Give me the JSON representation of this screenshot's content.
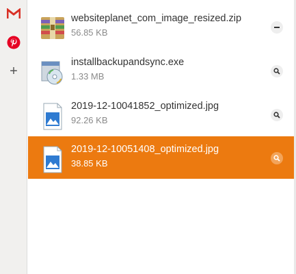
{
  "sidebar": {
    "icons": [
      "gmail-icon",
      "pinterest-icon",
      "add-icon"
    ],
    "add_glyph": "+"
  },
  "downloads": {
    "items": [
      {
        "name": "websiteplanet_com_image_resized.zip",
        "size": "56.85 KB",
        "icon": "zip-archive-icon",
        "action": "minus",
        "selected": false
      },
      {
        "name": "installbackupandsync.exe",
        "size": "1.33 MB",
        "icon": "installer-icon",
        "action": "search",
        "selected": false
      },
      {
        "name": "2019-12-10041852_optimized.jpg",
        "size": "92.26 KB",
        "icon": "image-file-icon",
        "action": "search",
        "selected": false
      },
      {
        "name": "2019-12-10051408_optimized.jpg",
        "size": "38.85 KB",
        "icon": "image-file-icon",
        "action": "search",
        "selected": true
      }
    ]
  },
  "colors": {
    "accent": "#ec7a10",
    "gmail": "#d93025",
    "pinterest": "#e60023"
  }
}
